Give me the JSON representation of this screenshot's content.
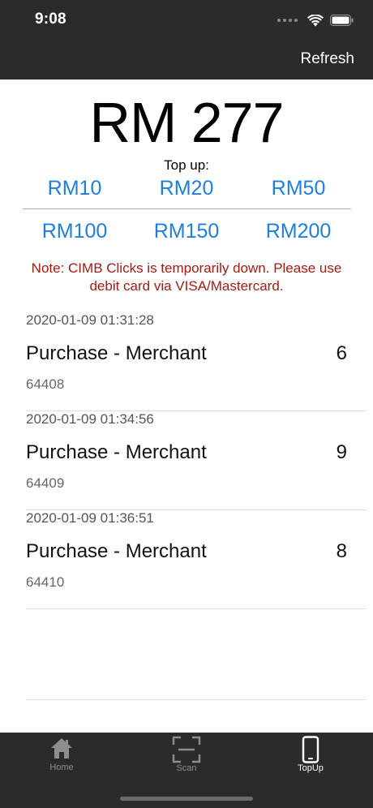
{
  "status_bar": {
    "time": "9:08"
  },
  "nav": {
    "refresh_label": "Refresh"
  },
  "balance": "RM 277",
  "topup": {
    "label": "Top up:",
    "amounts": [
      "RM10",
      "RM20",
      "RM50",
      "RM100",
      "RM150",
      "RM200"
    ]
  },
  "note": "Note: CIMB Clicks is temporarily down. Please use debit card via VISA/Mastercard.",
  "transactions": [
    {
      "datetime": "2020-01-09 01:31:28",
      "title": "Purchase - Merchant",
      "amount": "6",
      "id": "64408"
    },
    {
      "datetime": "2020-01-09 01:34:56",
      "title": "Purchase - Merchant",
      "amount": "9",
      "id": "64409"
    },
    {
      "datetime": "2020-01-09 01:36:51",
      "title": "Purchase - Merchant",
      "amount": "8",
      "id": "64410"
    }
  ],
  "tabs": [
    {
      "label": "Home",
      "icon": "home-icon",
      "active": false
    },
    {
      "label": "Scan",
      "icon": "scan-icon",
      "active": false
    },
    {
      "label": "TopUp",
      "icon": "phone-icon",
      "active": true
    }
  ],
  "colors": {
    "accent": "#1e7fe0",
    "note": "#a61a13",
    "bar_background": "#2b2b2b",
    "tab_inactive": "#8e8e8e",
    "tab_active": "#ffffff"
  }
}
